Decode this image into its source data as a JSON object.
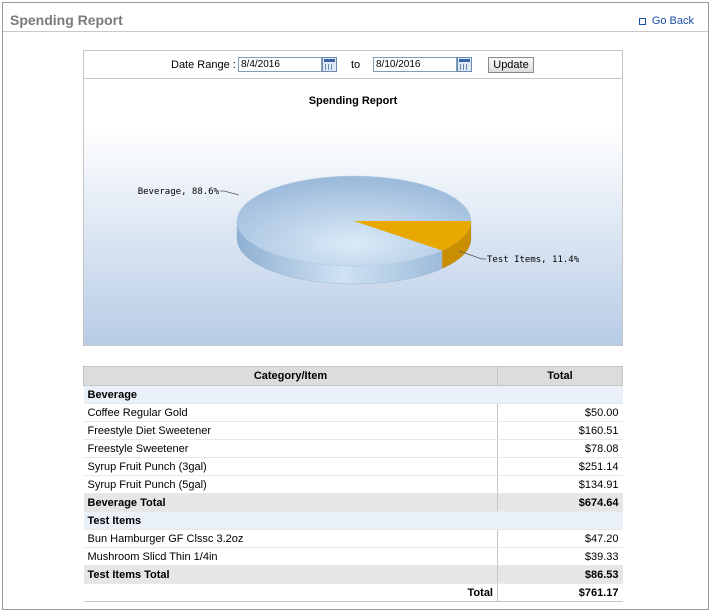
{
  "header": {
    "title": "Spending Report",
    "go_back": "Go Back"
  },
  "date_range": {
    "label": "Date Range :",
    "start": "8/4/2016",
    "to_label": "to",
    "end": "8/10/2016",
    "update_label": "Update"
  },
  "chart_data": {
    "type": "pie",
    "title": "Spending Report",
    "labels": [
      "Beverage",
      "Test Items"
    ],
    "values": [
      88.6,
      11.4
    ],
    "value_labels": [
      "Beverage, 88.6%",
      "Test Items, 11.4%"
    ],
    "colors": [
      "#a9c6e3",
      "#e8a800"
    ]
  },
  "table": {
    "col_category": "Category/Item",
    "col_total": "Total",
    "groups": [
      {
        "name": "Beverage",
        "items": [
          {
            "name": "Coffee Regular Gold",
            "total": "$50.00"
          },
          {
            "name": "Freestyle Diet Sweetener",
            "total": "$160.51"
          },
          {
            "name": "Freestyle Sweetener",
            "total": "$78.08"
          },
          {
            "name": "Syrup Fruit Punch (3gal)",
            "total": "$251.14"
          },
          {
            "name": "Syrup Fruit Punch (5gal)",
            "total": "$134.91"
          }
        ],
        "total_label": "Beverage Total",
        "total": "$674.64"
      },
      {
        "name": "Test Items",
        "items": [
          {
            "name": "Bun Hamburger GF Clssc 3.2oz",
            "total": "$47.20"
          },
          {
            "name": "Mushroom Slicd Thin 1/4in",
            "total": "$39.33"
          }
        ],
        "total_label": "Test Items Total",
        "total": "$86.53"
      }
    ],
    "grand_total_label": "Total",
    "grand_total": "$761.17"
  }
}
